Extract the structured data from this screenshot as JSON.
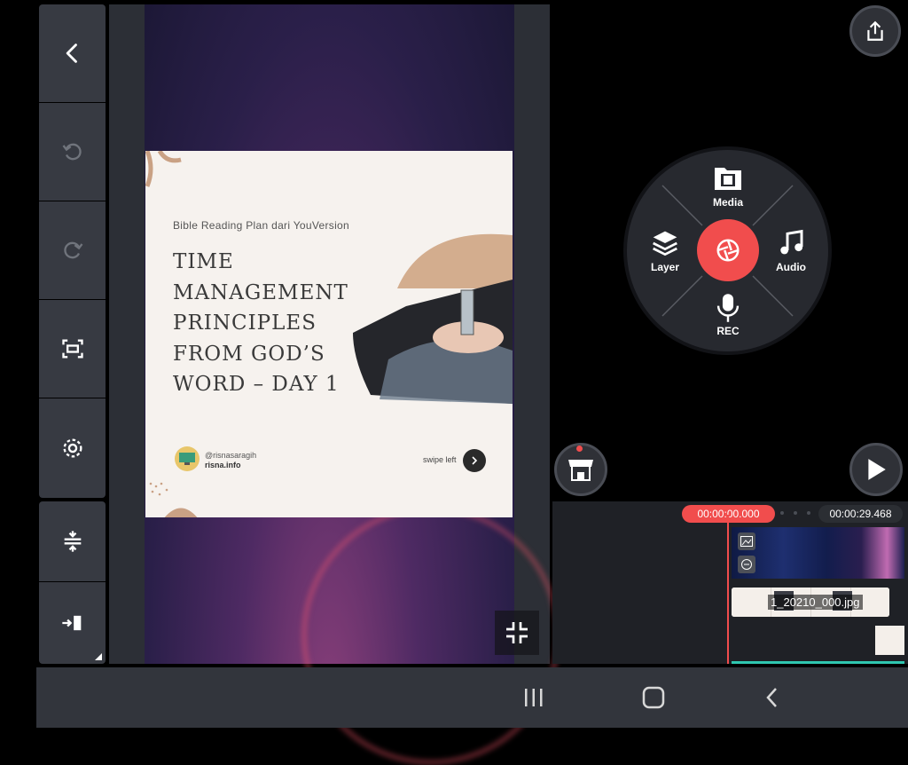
{
  "toolbar": {
    "items": [
      {
        "name": "back",
        "icon": "chevron-left-icon"
      },
      {
        "name": "undo",
        "icon": "undo-icon"
      },
      {
        "name": "redo",
        "icon": "redo-icon"
      },
      {
        "name": "aspect-ratio",
        "icon": "fit-screen-icon"
      },
      {
        "name": "settings",
        "icon": "gear-icon"
      },
      {
        "name": "adjust-tracks",
        "icon": "track-height-icon"
      },
      {
        "name": "jump-to-end",
        "icon": "jump-end-icon"
      }
    ]
  },
  "card": {
    "subtitle": "Bible Reading Plan dari YouVersion",
    "title_lines": [
      "TIME",
      "MANAGEMENT",
      "PRINCIPLES",
      "FROM GOD’S",
      "WORD – DAY 1"
    ],
    "username": "@risnasaragih",
    "website": "risna.info",
    "swipe_text": "swipe left"
  },
  "menu": {
    "media": "Media",
    "layer": "Layer",
    "audio": "Audio",
    "rec": "REC"
  },
  "timeline": {
    "current_time": "00:00:00.000",
    "total_time": "00:00:29.468",
    "clip_label": "1_20210_000.jpg"
  },
  "colors": {
    "accent": "#f14d4d",
    "panel": "#373a42",
    "background": "#000000"
  }
}
